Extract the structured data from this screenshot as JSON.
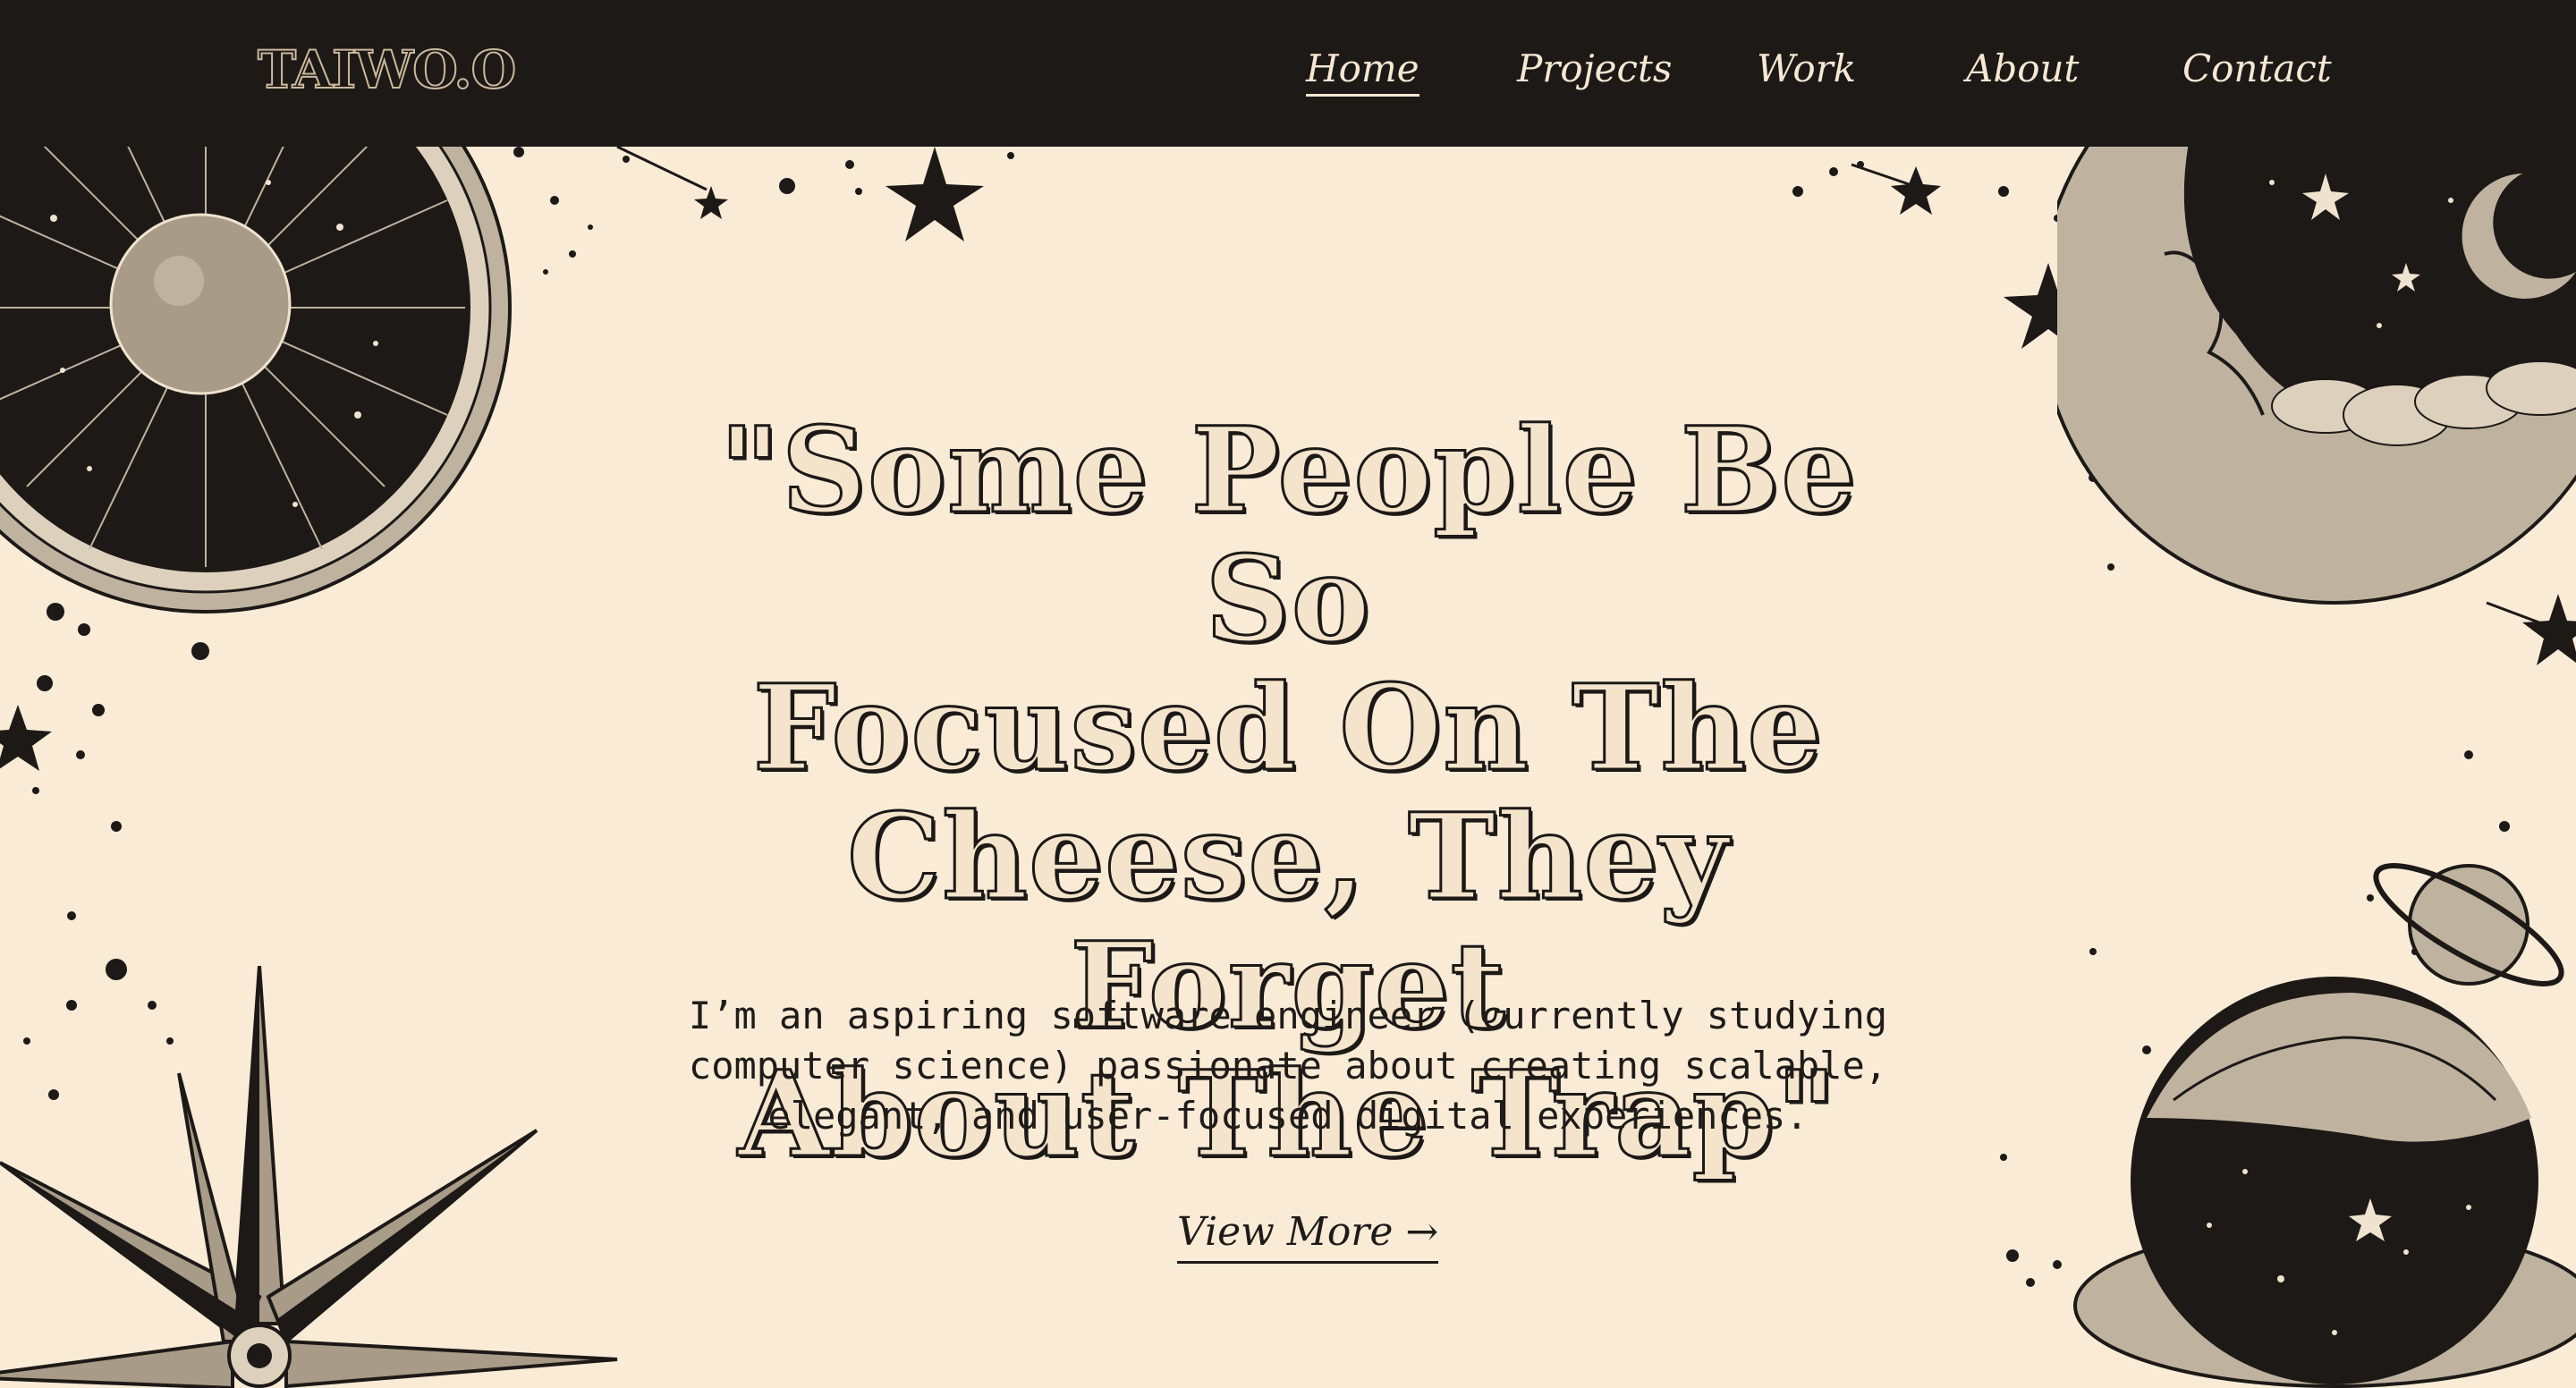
{
  "brand": {
    "logo_text": "TAIWO.O"
  },
  "nav": {
    "items": [
      {
        "label": "Home",
        "active": true
      },
      {
        "label": "Projects",
        "active": false
      },
      {
        "label": "Work",
        "active": false
      },
      {
        "label": "About",
        "active": false
      },
      {
        "label": "Contact",
        "active": false
      }
    ]
  },
  "hero": {
    "quote_lines": [
      "\"Some People Be So",
      "Focused On The",
      "Cheese, They Forget",
      "About The Trap\""
    ],
    "intro_lines": [
      "I’m an aspiring software engineer (currently studying",
      "computer science) passionate about creating scalable,",
      "elegant, and user-focused digital experiences."
    ],
    "cta_label": "View More",
    "cta_arrow": "→"
  },
  "decorations": [
    {
      "icon": "sun-compass-icon"
    },
    {
      "icon": "crescent-moon-face-icon"
    },
    {
      "icon": "compass-star-icon"
    },
    {
      "icon": "ringed-planet-icon"
    },
    {
      "icon": "celestial-globe-icon"
    }
  ],
  "colors": {
    "background": "#f9ebd6",
    "header": "#1c1917",
    "ink": "#1f1b18",
    "nav_text": "#f6e8d3"
  }
}
